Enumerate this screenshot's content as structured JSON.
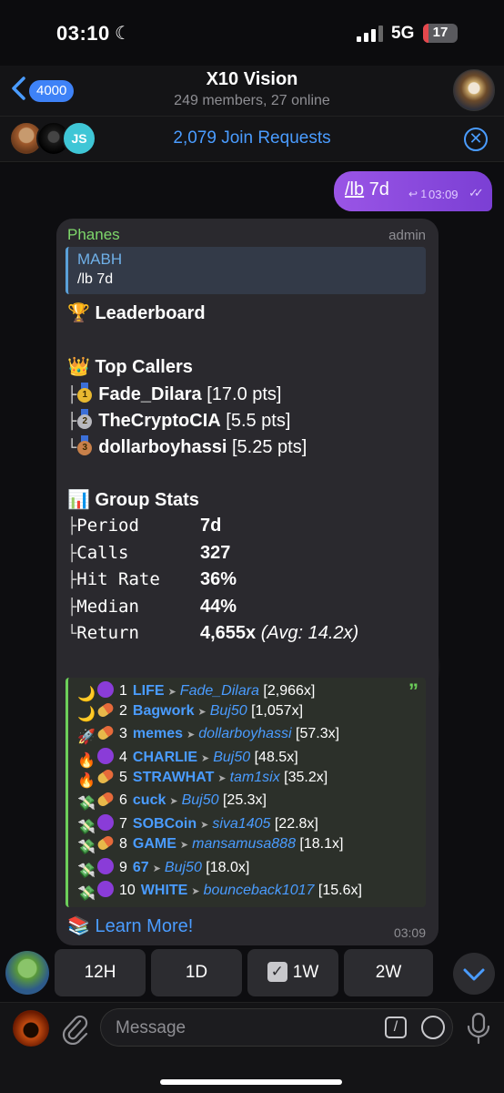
{
  "status_bar": {
    "time": "03:10",
    "network": "5G",
    "battery": "17",
    "battery_level": 0.17
  },
  "header": {
    "back_count": "4000",
    "title": "X10 Vision",
    "subtitle": "249 members, 27 online"
  },
  "join_bar": {
    "avatar_initials": "JS",
    "text": "2,079 Join Requests"
  },
  "outgoing": {
    "command": "/lb",
    "arg": " 7d",
    "reply_count": "1",
    "time": "03:09"
  },
  "message": {
    "sender": "Phanes",
    "role": "admin",
    "quote_name": "MABH",
    "quote_text": "/lb 7d",
    "leaderboard_title": "🏆 Leaderboard",
    "top_callers_title": "👑 Top Callers",
    "top_callers": [
      {
        "branch": "├",
        "medal": "1",
        "name": "Fade_Dilara",
        "pts": "[17.0 pts]"
      },
      {
        "branch": "├",
        "medal": "2",
        "name": "TheCryptoCIA",
        "pts": "[5.5 pts]"
      },
      {
        "branch": "└",
        "medal": "3",
        "name": "dollarboyhassi",
        "pts": "[5.25 pts]"
      }
    ],
    "group_stats_title": "📊 Group Stats",
    "stats": [
      {
        "branch": "├",
        "label": "Period",
        "value": "7d",
        "avg": ""
      },
      {
        "branch": "├",
        "label": "Calls",
        "value": "327",
        "avg": ""
      },
      {
        "branch": "├",
        "label": "Hit Rate",
        "value": "36%",
        "avg": ""
      },
      {
        "branch": "├",
        "label": "Median",
        "value": "44%",
        "avg": ""
      },
      {
        "branch": "└",
        "label": "Return",
        "value": "4,655x",
        "avg": "(Avg: 14.2x)"
      }
    ],
    "leaderboard": [
      {
        "icon1": "🌙",
        "icon2": "circle",
        "rank": "1",
        "token": "LIFE",
        "caller": "Fade_Dilara",
        "multiple": "[2,966x]"
      },
      {
        "icon1": "🌙",
        "icon2": "pill",
        "rank": "2",
        "token": "Bagwork",
        "caller": "Buj50",
        "multiple": "[1,057x]"
      },
      {
        "icon1": "🚀",
        "icon2": "pill",
        "rank": "3",
        "token": "memes",
        "caller": "dollarboyhassi",
        "multiple": "[57.3x]"
      },
      {
        "icon1": "🔥",
        "icon2": "circle",
        "rank": "4",
        "token": "CHARLIE",
        "caller": "Buj50",
        "multiple": "[48.5x]"
      },
      {
        "icon1": "🔥",
        "icon2": "pill",
        "rank": "5",
        "token": "STRAWHAT",
        "caller": "tam1six",
        "multiple": "[35.2x]"
      },
      {
        "icon1": "💸",
        "icon2": "pill",
        "rank": "6",
        "token": "cuck",
        "caller": "Buj50",
        "multiple": "[25.3x]"
      },
      {
        "icon1": "💸",
        "icon2": "circle",
        "rank": "7",
        "token": "SOBCoin",
        "caller": "siva1405",
        "multiple": "[22.8x]"
      },
      {
        "icon1": "💸",
        "icon2": "pill",
        "rank": "8",
        "token": "GAME",
        "caller": "mansamusa888",
        "multiple": "[18.1x]"
      },
      {
        "icon1": "💸",
        "icon2": "circle",
        "rank": "9",
        "token": "67",
        "caller": "Buj50",
        "multiple": "[18.0x]"
      },
      {
        "icon1": "💸",
        "icon2": "circle",
        "rank": "10",
        "token": "WHITE",
        "caller": "bounceback1017",
        "multiple": "[15.6x]"
      }
    ],
    "learn_more": "📚 Learn More!",
    "time": "03:09"
  },
  "keyboard": [
    "12H",
    "1D",
    "1W",
    "2W"
  ],
  "input": {
    "placeholder": "Message"
  }
}
